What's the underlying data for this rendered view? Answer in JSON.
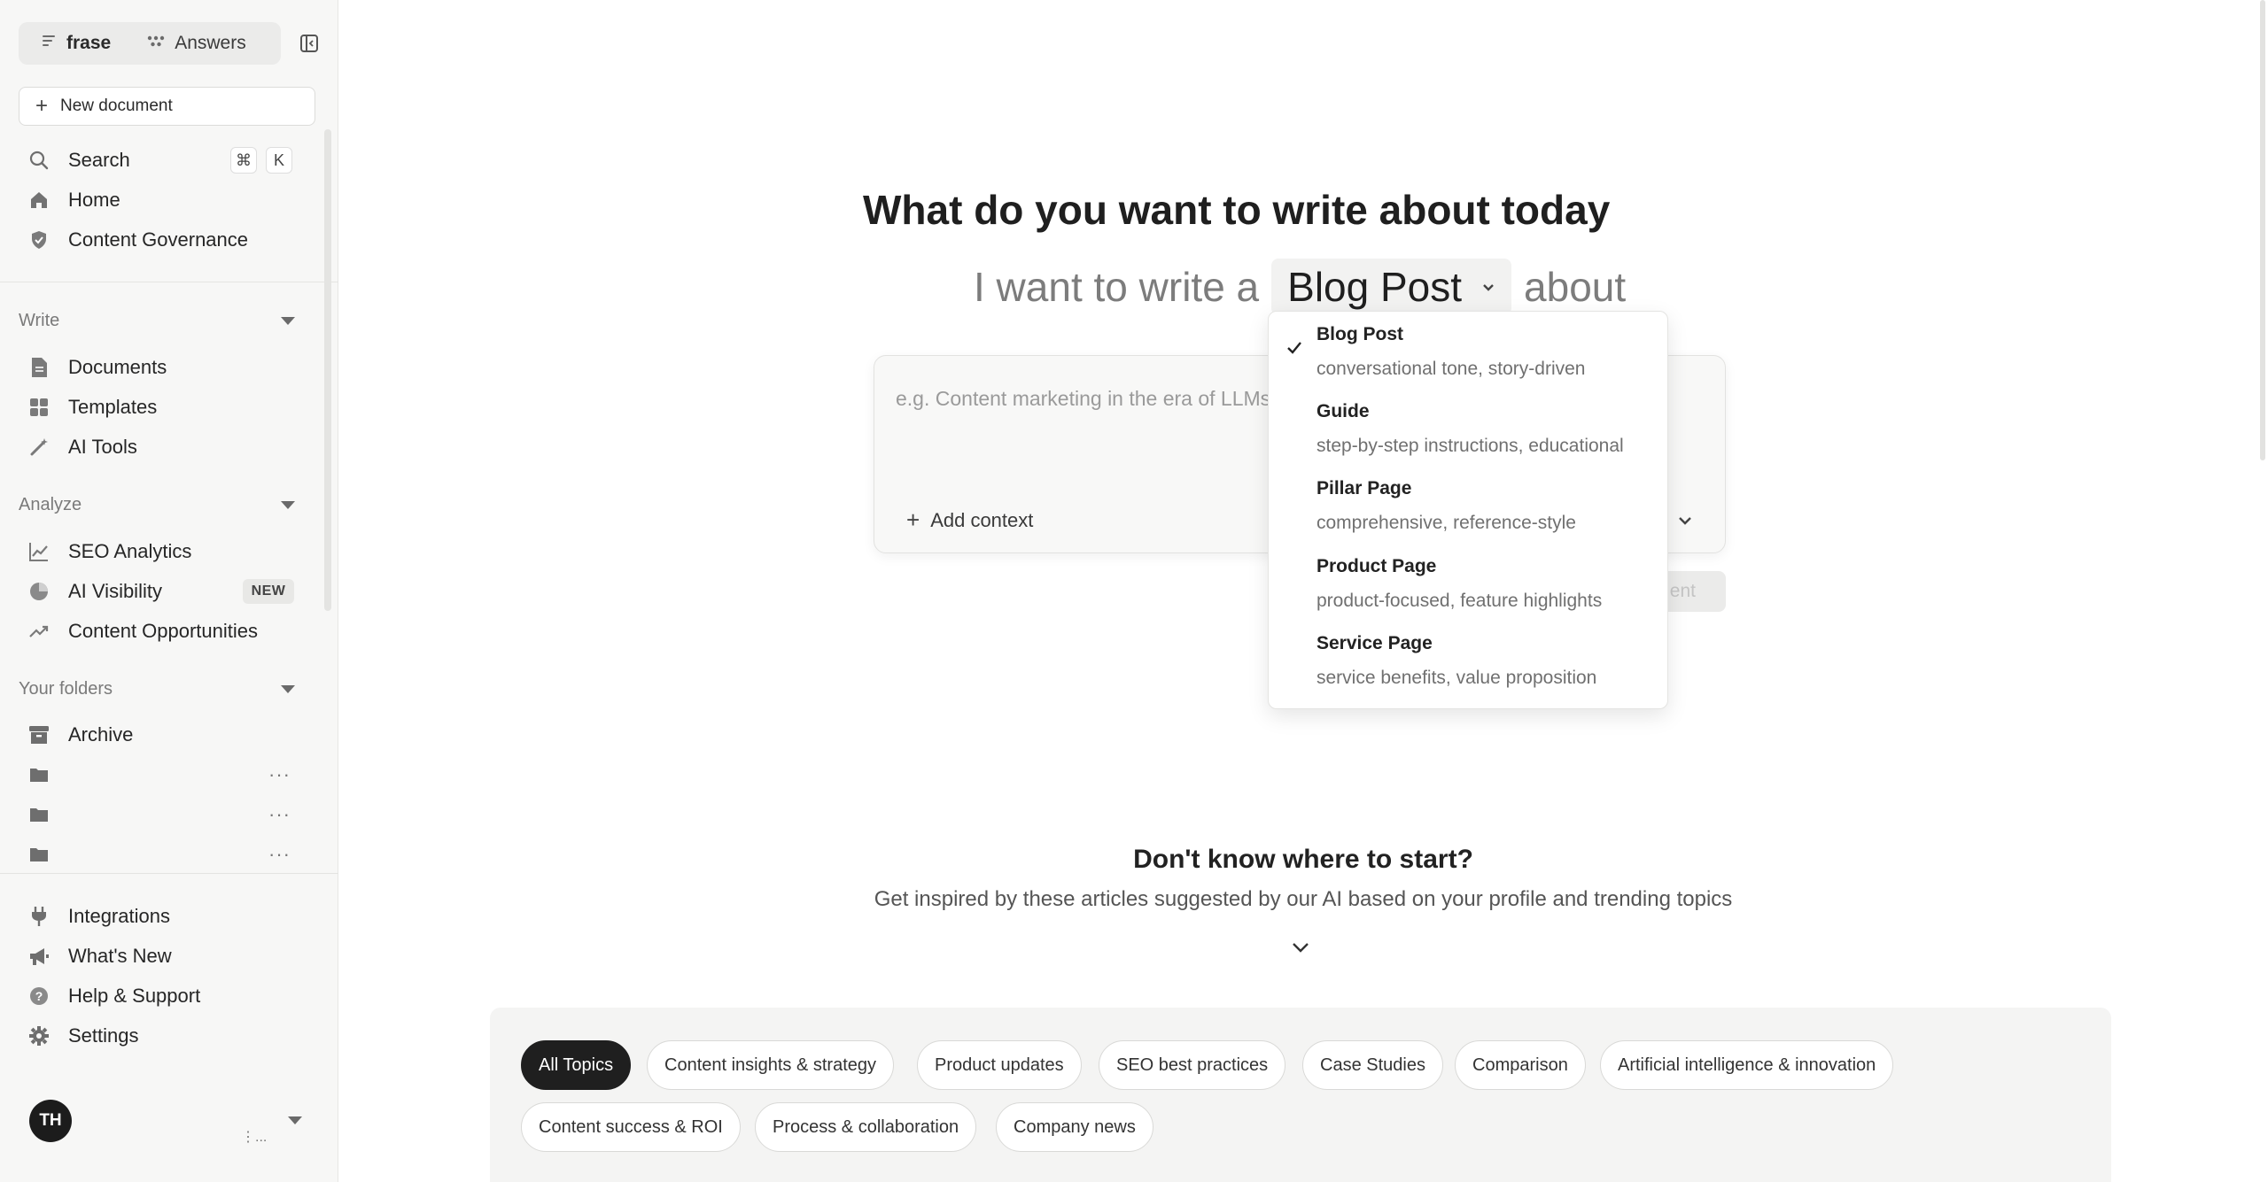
{
  "app_switcher": {
    "frase_label": "frase",
    "answers_label": "Answers"
  },
  "sidebar": {
    "new_document": "New document",
    "search": {
      "label": "Search",
      "shortcut_mod": "⌘",
      "shortcut_key": "K"
    },
    "top_items": [
      {
        "label": "Home",
        "icon": "home-icon"
      },
      {
        "label": "Content Governance",
        "icon": "shield-icon"
      }
    ],
    "write": {
      "heading": "Write",
      "items": [
        {
          "label": "Documents",
          "icon": "document-icon"
        },
        {
          "label": "Templates",
          "icon": "grid-icon"
        },
        {
          "label": "AI Tools",
          "icon": "wand-icon"
        }
      ]
    },
    "analyze": {
      "heading": "Analyze",
      "items": [
        {
          "label": "SEO Analytics",
          "icon": "chart-line-icon"
        },
        {
          "label": "AI Visibility",
          "icon": "pie-icon",
          "badge": "NEW"
        },
        {
          "label": "Content Opportunities",
          "icon": "trend-up-icon"
        }
      ]
    },
    "folders": {
      "heading": "Your folders",
      "archive": "Archive",
      "folder_menu": "···"
    },
    "bottom_items": [
      {
        "label": "Integrations",
        "icon": "plug-icon"
      },
      {
        "label": "What's New",
        "icon": "megaphone-icon"
      },
      {
        "label": "Help & Support",
        "icon": "help-icon"
      },
      {
        "label": "Settings",
        "icon": "gear-icon"
      }
    ],
    "user": {
      "initials": "TH",
      "menu": "⋮..."
    }
  },
  "main": {
    "title": "What do you want to write about today",
    "sentence_prefix": "I want to write a",
    "selected_type": "Blog Post",
    "sentence_suffix": "about",
    "prompt_placeholder": "e.g. Content marketing in the era of LLMs",
    "add_context": "Add context",
    "create_button": "Create Content",
    "create_button_visible": "ent"
  },
  "dropdown": {
    "items": [
      {
        "label": "Blog Post",
        "desc": "conversational tone, story-driven",
        "selected": true
      },
      {
        "label": "Guide",
        "desc": "step-by-step instructions, educational",
        "selected": false
      },
      {
        "label": "Pillar Page",
        "desc": "comprehensive, reference-style",
        "selected": false
      },
      {
        "label": "Product Page",
        "desc": "product-focused, feature highlights",
        "selected": false
      },
      {
        "label": "Service Page",
        "desc": "service benefits, value proposition",
        "selected": false
      }
    ]
  },
  "inspiration": {
    "title": "Don't know where to start?",
    "subtitle": "Get inspired by these articles suggested by our AI based on your profile and trending topics",
    "topics": [
      "All Topics",
      "Content insights & strategy",
      "Product updates",
      "SEO best practices",
      "Case Studies",
      "Comparison",
      "Artificial intelligence & innovation",
      "Content success & ROI",
      "Process & collaboration",
      "Company news"
    ],
    "active_topic": "All Topics"
  },
  "colors": {
    "sidebar_bg": "#f7f7f6",
    "chip_active_bg": "#1f1f1f",
    "text_primary": "#1f1f1f",
    "text_muted": "#7c7c7c"
  }
}
